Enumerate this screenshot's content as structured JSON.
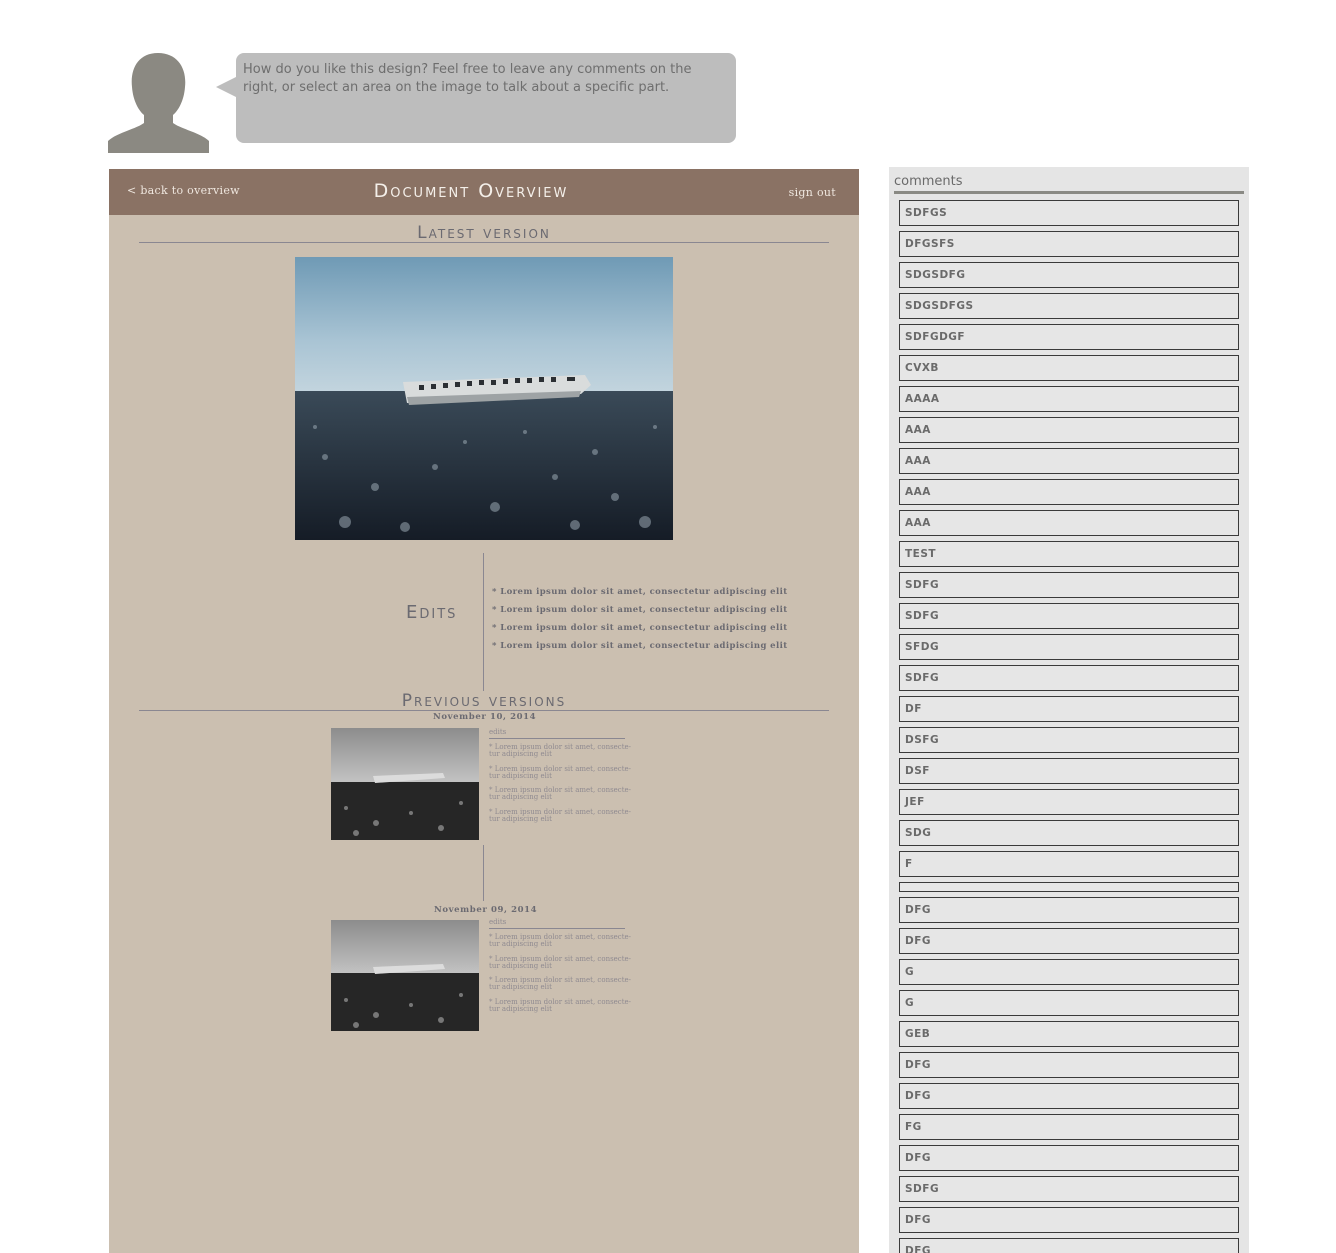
{
  "bubble": {
    "text": "How do you like this design? Feel free to leave any comments on the right, or select an area on the image to talk about a specific part."
  },
  "header": {
    "back_label": "< back to overview",
    "title": "Document Overview",
    "sign_out_label": "sign out"
  },
  "latest": {
    "title": "Latest version",
    "edits_label": "Edits",
    "edits": [
      "* Lorem ipsum dolor sit amet, consectetur adipiscing elit",
      "* Lorem ipsum dolor sit amet, consectetur adipiscing elit",
      "* Lorem ipsum dolor sit amet, consectetur adipiscing elit",
      "* Lorem ipsum dolor sit amet, consectetur adipiscing elit"
    ]
  },
  "previous": {
    "title": "Previous versions",
    "versions": [
      {
        "date": "November 10, 2014",
        "edits_head": "edits",
        "edits": [
          "* Lorem ipsum dolor sit amet, consecte-tur adipiscing elit",
          "* Lorem ipsum dolor sit amet, consecte-tur adipiscing elit",
          "* Lorem ipsum dolor sit amet, consecte-tur adipiscing elit",
          "* Lorem ipsum dolor sit amet, consecte-tur adipiscing elit"
        ]
      },
      {
        "date": "November 09, 2014",
        "edits_head": "edits",
        "edits": [
          "* Lorem ipsum dolor sit amet, consecte-tur adipiscing elit",
          "* Lorem ipsum dolor sit amet, consecte-tur adipiscing elit",
          "* Lorem ipsum dolor sit amet, consecte-tur adipiscing elit",
          "* Lorem ipsum dolor sit amet, consecte-tur adipiscing elit"
        ]
      }
    ]
  },
  "comments": {
    "title": "comments",
    "items": [
      "sdfgs",
      "dfgsfs",
      "sdgsdfg",
      "sdgsdfgs",
      "sdfgdgf",
      "cvxb",
      "aaaa",
      "aaa",
      "aaa",
      "aaa",
      "aaa",
      "test",
      "sdfg",
      "sdfg",
      "sfdg",
      "sdfg",
      "df",
      "dsfg",
      "dsf",
      "jef",
      "sdg",
      "f",
      "",
      "dfg",
      "dfg",
      "g",
      "g",
      "geb",
      "dfg",
      "dfg",
      "fg",
      "dfg",
      "sdfg",
      "dfg",
      "dfg"
    ]
  },
  "colors": {
    "topbar": "#8a7264",
    "frame_bg": "#cbbfb0",
    "panel_bg": "#e5e5e5",
    "bubble_bg": "#bdbdbd"
  }
}
